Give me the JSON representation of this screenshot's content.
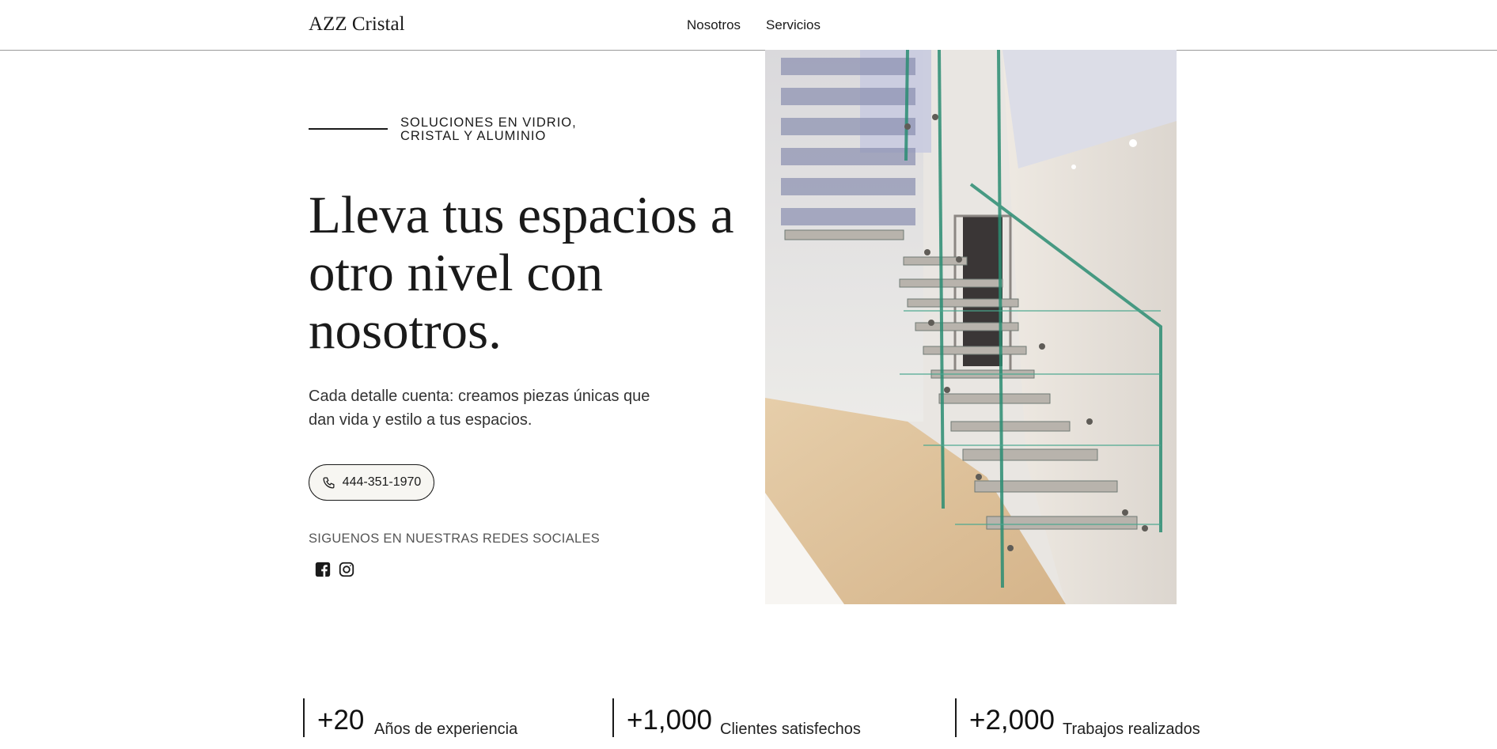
{
  "header": {
    "logo": "AZZ Cristal",
    "nav": [
      {
        "label": "Nosotros"
      },
      {
        "label": "Servicios"
      }
    ]
  },
  "hero": {
    "eyebrow_line1": "SOLUCIONES EN VIDRIO,",
    "eyebrow_line2": "CRISTAL Y ALUMINIO",
    "title": "Lleva tus espacios a otro nivel con nosotros.",
    "subtitle": "Cada detalle cuenta: creamos piezas únicas que dan vida y estilo a tus espacios.",
    "phone": "444-351-1970",
    "phone_icon": "phone-icon",
    "social_label": "SIGUENOS EN NUESTRAS REDES SOCIALES",
    "social_icons": [
      "facebook-icon",
      "instagram-icon"
    ],
    "image_subject": "glass-staircase-photo"
  },
  "stats": [
    {
      "value": "+20",
      "label": "Años de experiencia"
    },
    {
      "value": "+1,000",
      "label": "Clientes satisfechos"
    },
    {
      "value": "+2,000",
      "label": "Trabajos realizados"
    }
  ],
  "colors": {
    "text": "#1a1a1a",
    "muted": "#555555",
    "header_border": "#9a9a9a",
    "button_bg": "#f7f6f2"
  }
}
